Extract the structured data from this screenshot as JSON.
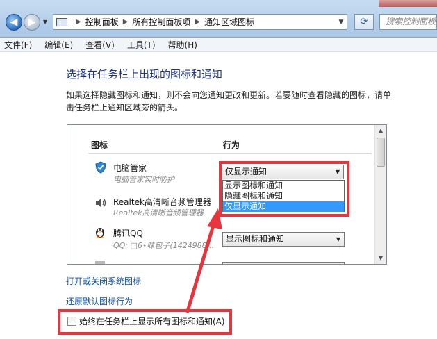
{
  "address_bar": {
    "crumbs": [
      "控制面板",
      "所有控制面板项",
      "通知区域图标"
    ],
    "search_placeholder": "搜索控制面板"
  },
  "menu": [
    "文件(F)",
    "编辑(E)",
    "查看(V)",
    "工具(T)",
    "帮助(H)"
  ],
  "main": {
    "heading": "选择在任务栏上出现的图标和通知",
    "description": "如果选择隐藏图标和通知，则不会向您通知更改和更新。若要随时查看隐藏的图标，请单击任务栏上通知区域旁的箭头。",
    "col_icon": "图标",
    "col_behavior": "行为",
    "rows": [
      {
        "name": "电脑管家",
        "sub": "电脑管家实时防护",
        "behavior": "仅显示通知"
      },
      {
        "name": "Realtek高清晰音频管理器",
        "sub": "Realtek高清晰音频管理器"
      },
      {
        "name": "腾讯QQ",
        "sub": "QQ: □6•味包子(1424988...",
        "behavior": "显示图标和通知"
      }
    ],
    "dropdown_options": [
      "显示图标和通知",
      "隐藏图标和通知",
      "仅显示通知"
    ],
    "dropdown_selected_index": 2,
    "link_system_icons": "打开或关闭系统图标",
    "link_restore": "还原默认图标行为",
    "checkbox_label": "始终在任务栏上显示所有图标和通知(A)",
    "checkbox_checked": false
  },
  "colors": {
    "highlight": "#e8343c",
    "link": "#0b4fa8",
    "selected": "#3399ff",
    "heading": "#1e3287"
  }
}
